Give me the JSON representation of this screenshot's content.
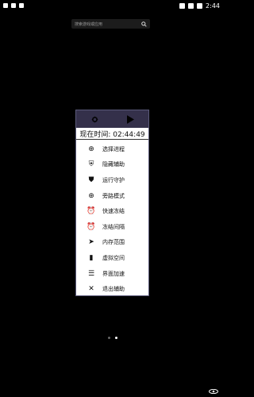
{
  "status_bar": {
    "time": "2:44"
  },
  "search": {
    "placeholder": "搜索游戏或应用"
  },
  "menu": {
    "clock_label": "现在时间: 02:44:49",
    "items": [
      {
        "label": "选择进程",
        "icon": "target-icon"
      },
      {
        "label": "隐藏辅助",
        "icon": "shield-icon"
      },
      {
        "label": "运行守护",
        "icon": "shield-check-icon"
      },
      {
        "label": "旁路模式",
        "icon": "target-icon"
      },
      {
        "label": "快速冻结",
        "icon": "alarm-icon"
      },
      {
        "label": "冻结间隔",
        "icon": "alarm-icon"
      },
      {
        "label": "内存范围",
        "icon": "send-icon"
      },
      {
        "label": "虚拟空间",
        "icon": "sd-card-icon"
      },
      {
        "label": "界面加速",
        "icon": "list-icon"
      },
      {
        "label": "退出辅助",
        "icon": "close-icon"
      }
    ]
  }
}
